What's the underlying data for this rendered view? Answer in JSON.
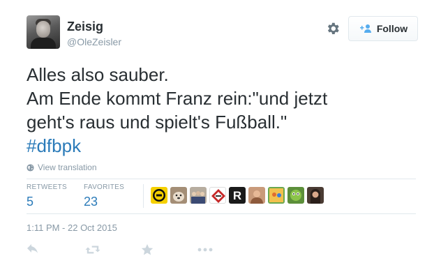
{
  "user": {
    "name": "Zeisig",
    "handle": "@OleZeisler"
  },
  "header": {
    "follow_label": "Follow",
    "settings_icon": "gear-icon",
    "follow_icon": "add-user-icon"
  },
  "tweet": {
    "lines": [
      "Alles also sauber.",
      "Am Ende kommt Franz rein:\"und jetzt",
      "geht's raus und spielt's Fußball.\""
    ],
    "hashtag": "#dfbpk",
    "translate_label": "View translation"
  },
  "stats": {
    "retweets_label": "RETWEETS",
    "retweets_count": "5",
    "favorites_label": "FAVORITES",
    "favorites_count": "23"
  },
  "favoriter_avatars": [
    {
      "icon": "bvb-logo-avatar",
      "bg": "#f5d000"
    },
    {
      "icon": "dog-avatar",
      "bg": "#a48e76"
    },
    {
      "icon": "group-photo-avatar",
      "bg": "#b7ad9f"
    },
    {
      "icon": "diamond-logo-avatar",
      "bg": "#ffffff"
    },
    {
      "icon": "letter-r-avatar",
      "bg": "#1a1a1a"
    },
    {
      "icon": "person-avatar",
      "bg": "#c99a7a"
    },
    {
      "icon": "cartoon-avatar",
      "bg": "#6aa84f"
    },
    {
      "icon": "green-character-avatar",
      "bg": "#5c8f3a"
    },
    {
      "icon": "woman-avatar",
      "bg": "#4a3b33"
    }
  ],
  "timestamp": "1:11 PM - 22 Oct 2015",
  "actions": [
    "reply-icon",
    "retweet-icon",
    "favorite-star-icon",
    "more-dots-icon"
  ],
  "colors": {
    "link": "#2b7bb9",
    "muted": "#8899a6",
    "text": "#292f33",
    "border": "#e1e8ed"
  }
}
